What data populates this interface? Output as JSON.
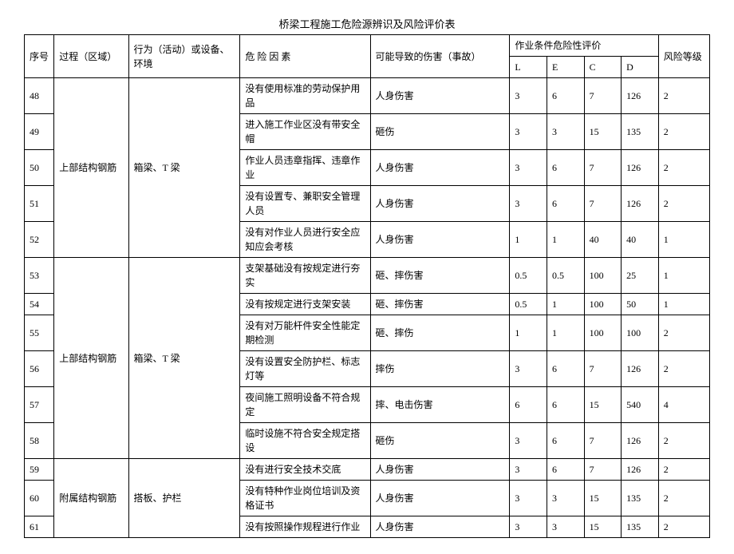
{
  "title": "桥梁工程施工危险源辨识及风险评价表",
  "headers": {
    "seq": "序号",
    "area": "过程（区域）",
    "activity": "行为（活动）或设备、环境",
    "factor": "危 险 因 素",
    "harm": "可能导致的伤害（事故）",
    "eval_group": "作业条件危险性评价",
    "l": "L",
    "e": "E",
    "c": "C",
    "d": "D",
    "level": "风险等级"
  },
  "groups": [
    {
      "area": "上部结构钢筋",
      "activity": "箱梁、T 梁",
      "rows": [
        {
          "seq": "48",
          "factor": "没有使用标准的劳动保护用品",
          "harm": "人身伤害",
          "l": "3",
          "e": "6",
          "c": "7",
          "d": "126",
          "level": "2"
        },
        {
          "seq": "49",
          "factor": "进入施工作业区没有带安全帽",
          "harm": "砸伤",
          "l": "3",
          "e": "3",
          "c": "15",
          "d": "135",
          "level": "2"
        },
        {
          "seq": "50",
          "factor": "作业人员违章指挥、违章作业",
          "harm": "人身伤害",
          "l": "3",
          "e": "6",
          "c": "7",
          "d": "126",
          "level": "2"
        },
        {
          "seq": "51",
          "factor": "没有设置专、兼职安全管理人员",
          "harm": "人身伤害",
          "l": "3",
          "e": "6",
          "c": "7",
          "d": "126",
          "level": "2"
        },
        {
          "seq": "52",
          "factor": "没有对作业人员进行安全应知应会考核",
          "harm": "人身伤害",
          "l": "1",
          "e": "1",
          "c": "40",
          "d": "40",
          "level": "1"
        }
      ]
    },
    {
      "area": "上部结构钢筋",
      "activity": "箱梁、T 梁",
      "rows": [
        {
          "seq": "53",
          "factor": "支架基础没有按规定进行夯实",
          "harm": "砸、摔伤害",
          "l": "0.5",
          "e": "0.5",
          "c": "100",
          "d": "25",
          "level": "1"
        },
        {
          "seq": "54",
          "factor": "没有按规定进行支架安装",
          "harm": "砸、摔伤害",
          "l": "0.5",
          "e": "1",
          "c": "100",
          "d": "50",
          "level": "1"
        },
        {
          "seq": "55",
          "factor": "没有对万能杆件安全性能定期检测",
          "harm": "砸、摔伤",
          "l": "1",
          "e": "1",
          "c": "100",
          "d": "100",
          "level": "2"
        },
        {
          "seq": "56",
          "factor": "没有设置安全防护栏、标志灯等",
          "harm": "摔伤",
          "l": "3",
          "e": "6",
          "c": "7",
          "d": "126",
          "level": "2"
        },
        {
          "seq": "57",
          "factor": "夜间施工照明设备不符合规定",
          "harm": "摔、电击伤害",
          "l": "6",
          "e": "6",
          "c": "15",
          "d": "540",
          "level": "4"
        },
        {
          "seq": "58",
          "factor": "临时设施不符合安全规定搭设",
          "harm": "砸伤",
          "l": "3",
          "e": "6",
          "c": "7",
          "d": "126",
          "level": "2"
        }
      ]
    },
    {
      "area": "附属结构钢筋",
      "activity": "搭板、护栏",
      "rows": [
        {
          "seq": "59",
          "factor": "没有进行安全技术交底",
          "harm": "人身伤害",
          "l": "3",
          "e": "6",
          "c": "7",
          "d": "126",
          "level": "2"
        },
        {
          "seq": "60",
          "factor": "没有特种作业岗位培训及资格证书",
          "harm": "人身伤害",
          "l": "3",
          "e": "3",
          "c": "15",
          "d": "135",
          "level": "2"
        },
        {
          "seq": "61",
          "factor": "没有按照操作规程进行作业",
          "harm": "人身伤害",
          "l": "3",
          "e": "3",
          "c": "15",
          "d": "135",
          "level": "2"
        }
      ]
    }
  ]
}
